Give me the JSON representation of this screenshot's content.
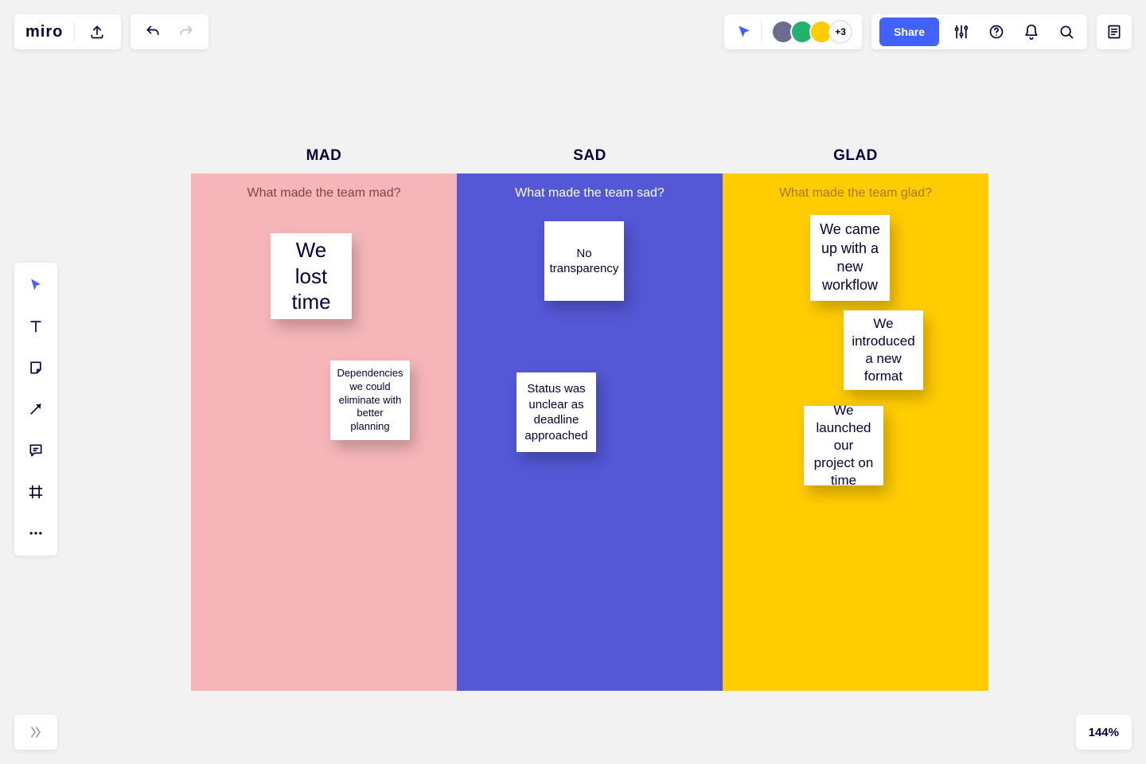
{
  "app": {
    "logo": "miro"
  },
  "presence": {
    "more": "+3"
  },
  "share": {
    "label": "Share"
  },
  "zoom": {
    "label": "144%"
  },
  "columns": {
    "mad": {
      "title": "MAD",
      "prompt": "What made the team mad?"
    },
    "sad": {
      "title": "SAD",
      "prompt": "What made the team sad?"
    },
    "glad": {
      "title": "GLAD",
      "prompt": "What made the team glad?"
    }
  },
  "notes": {
    "mad1": "We lost time",
    "mad2": "Dependencies we could eliminate with better planning",
    "sad1": "No transparency",
    "sad2": "Status was unclear as deadline approached",
    "glad1": "We came up with a new workflow",
    "glad2": "We introduced a new format",
    "glad3": "We launched our project on time"
  }
}
